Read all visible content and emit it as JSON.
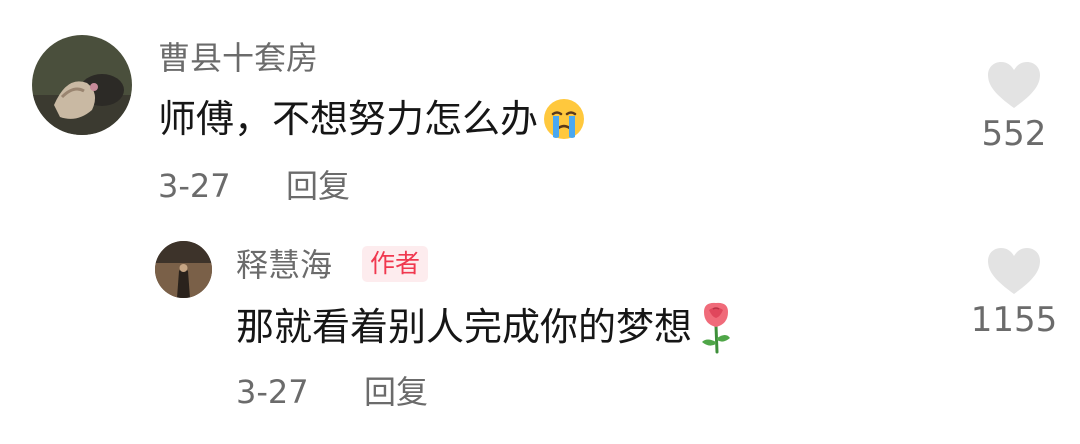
{
  "comments": [
    {
      "username": "曹县十套房",
      "text": "师傅，不想努力怎么办",
      "emoji": "crying-face-emoji",
      "date": "3-27",
      "reply_label": "回复",
      "likes": "552"
    }
  ],
  "reply": {
    "username": "释慧海",
    "badge": "作者",
    "text": "那就看着别人完成你的梦想",
    "emoji": "rose-emoji",
    "date": "3-27",
    "reply_label": "回复",
    "likes": "1155"
  },
  "colors": {
    "secondary_text": "#6b6b6b",
    "primary_text": "#161616",
    "heart": "#e3e3e3",
    "badge_bg": "#fdecee",
    "badge_text": "#f0384f"
  }
}
